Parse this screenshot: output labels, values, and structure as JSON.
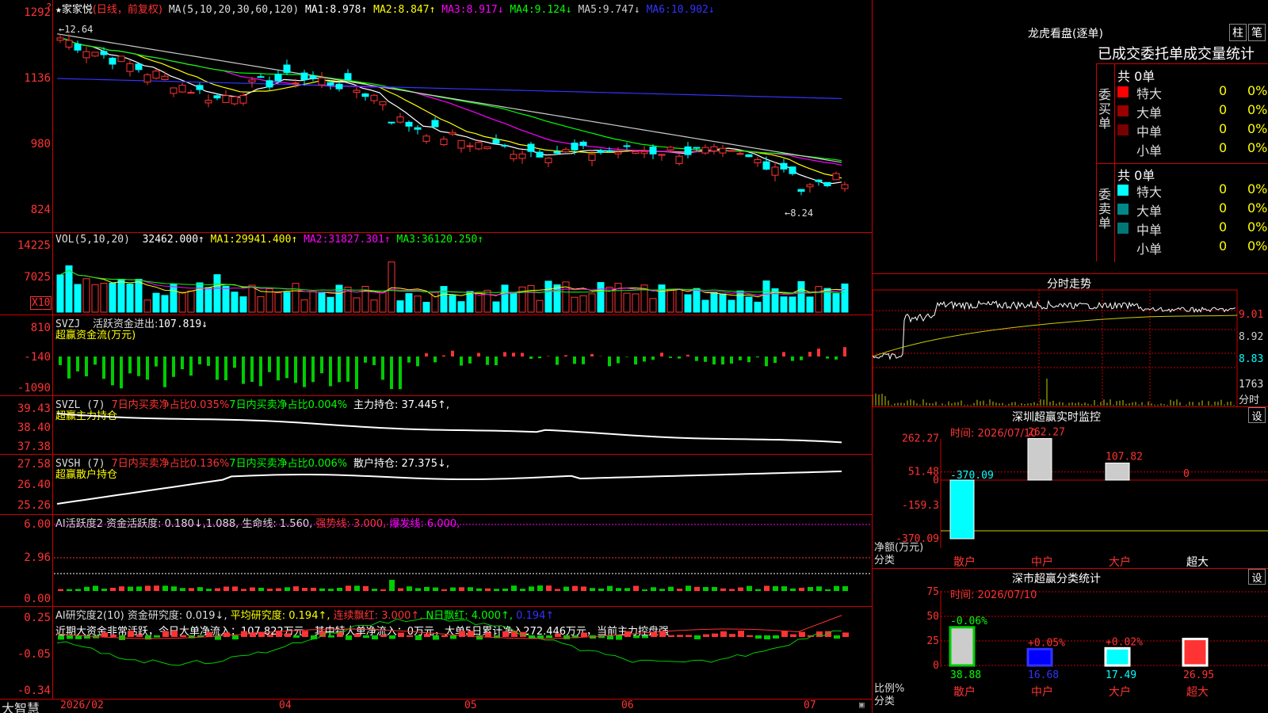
{
  "stock": {
    "name": "家家悦",
    "period": "(日线，前复权)",
    "ma_label": "MA(5,10,20,30,60,120)",
    "ma": [
      {
        "k": "MA1:",
        "v": "8.978↑",
        "c": "#fff"
      },
      {
        "k": "MA2:",
        "v": "8.847↑",
        "c": "#ff0"
      },
      {
        "k": "MA3:",
        "v": "8.917↓",
        "c": "#f0f"
      },
      {
        "k": "MA4:",
        "v": "9.124↓",
        "c": "#0f0"
      },
      {
        "k": "MA5:",
        "v": "9.747↓",
        "c": "#ccc"
      },
      {
        "k": "MA6:",
        "v": "10.902↓",
        "c": "#33f"
      }
    ],
    "y_ticks": [
      "1292",
      "1136",
      "980",
      "824"
    ],
    "high_mark": "←12.64",
    "low_mark": "←8.24"
  },
  "vol": {
    "label": "VOL(5,10,20)",
    "value": "32462.000↑",
    "ma": [
      {
        "k": "MA1:",
        "v": "29941.400↑",
        "c": "#ff0"
      },
      {
        "k": "MA2:",
        "v": "31827.301↑",
        "c": "#f0f"
      },
      {
        "k": "MA3:",
        "v": "36120.250↑",
        "c": "#0f0"
      }
    ],
    "y_ticks": [
      "14225",
      "7025"
    ],
    "unit": "X10"
  },
  "svzj": {
    "label": "SVZJ",
    "text": "活跃资金进出:",
    "value": "107.819↓",
    "sub": "超赢资金流(万元)",
    "y_ticks": [
      "810",
      "-140",
      "-1090"
    ]
  },
  "svzl": {
    "label": "SVZL (7)",
    "a": "7日内买卖净占比0.035%",
    "b": "7日内买卖净占比0.004%",
    "c": "主力持仓: 37.445↑,",
    "sub": "超赢主力持仓",
    "y_ticks": [
      "39.43",
      "38.40",
      "37.38"
    ]
  },
  "svsh": {
    "label": "SVSH (7)",
    "a": "7日内买卖净占比0.136%",
    "b": "7日内买卖净占比0.006%",
    "c": "散户持仓: 27.375↓,",
    "sub": "超赢散户持仓",
    "y_ticks": [
      "27.58",
      "26.40",
      "25.26"
    ]
  },
  "ai1": {
    "label": "AI活跃度2",
    "a": "资金活跃度: 0.180↓,1.088,",
    "b": "生命线: 1.560,",
    "c": "强势线: 3.000,",
    "d": "爆发线: 6.000,",
    "y_ticks": [
      "6.00",
      "2.96",
      "0.00"
    ]
  },
  "ai2": {
    "label": "AI研究度2(10)",
    "a": "资金研究度: 0.019↓,",
    "b": "平均研究度: 0.194↑,",
    "c": "连续飘红: 3.000↑,",
    "d": "N日飘红: 4.000↑,",
    "e": "0.194↑",
    "sentence": "近期大资金非常活跃，今日大单净流入：107.822万元，其中特大单净流入：0万元，大单5日累计净入272.446万元，当前主力控盘强",
    "y_ticks": [
      "0.25",
      "-0.05",
      "-0.34"
    ]
  },
  "xaxis": {
    "labels": [
      "2026/02",
      "04",
      "05",
      "06",
      "07"
    ],
    "brand": "大智慧"
  },
  "dragon": {
    "title": "龙虎看盘(逐单)",
    "btn1": "柱",
    "btn2": "笔",
    "subtitle": "已成交委托单成交量统计",
    "buy": {
      "side": "委买单",
      "total": "共 0单",
      "rows": [
        {
          "n": "特大",
          "v": "0",
          "p": "0%",
          "c": "#f00"
        },
        {
          "n": "大单",
          "v": "0",
          "p": "0%",
          "c": "#900"
        },
        {
          "n": "中单",
          "v": "0",
          "p": "0%",
          "c": "#700"
        },
        {
          "n": "小单",
          "v": "0",
          "p": "0%",
          "c": ""
        }
      ]
    },
    "sell": {
      "side": "委卖单",
      "total": "共 0单",
      "rows": [
        {
          "n": "特大",
          "v": "0",
          "p": "0%",
          "c": "#0ff"
        },
        {
          "n": "大单",
          "v": "0",
          "p": "0%",
          "c": "#088"
        },
        {
          "n": "中单",
          "v": "0",
          "p": "0%",
          "c": "#077"
        },
        {
          "n": "小单",
          "v": "0",
          "p": "0%",
          "c": ""
        }
      ]
    }
  },
  "fenshi": {
    "title": "分时走势",
    "y_ticks": [
      "9.01",
      "8.92",
      "8.83"
    ],
    "vol": "1763",
    "unit": "分时"
  },
  "sz_monitor": {
    "title": "深圳超赢实时监控",
    "btn": "设",
    "time": "时间: 2026/07/10",
    "y_ticks": [
      "262.27",
      "51.48",
      "0",
      "-159.3",
      "-370.09"
    ],
    "ylabel": "净额(万元)",
    "xlabel": "分类",
    "categories": [
      "散户",
      "中户",
      "大户",
      "超大"
    ],
    "values": [
      -370.09,
      262.27,
      107.82,
      0
    ],
    "value_labels": [
      "-370.09",
      "262.27",
      "107.82",
      "0"
    ]
  },
  "sz_class": {
    "title": "深市超赢分类统计",
    "btn": "设",
    "time": "时间: 2026/07/10",
    "y_ticks": [
      "75",
      "50",
      "25",
      "0"
    ],
    "ylabel": "比例%",
    "xlabel": "分类",
    "categories": [
      "散户",
      "中户",
      "大户",
      "超大"
    ],
    "values": [
      38.88,
      16.68,
      17.49,
      26.95
    ],
    "change_labels": [
      "-0.06%",
      "+0.05%",
      "+0.02%",
      ""
    ]
  }
}
